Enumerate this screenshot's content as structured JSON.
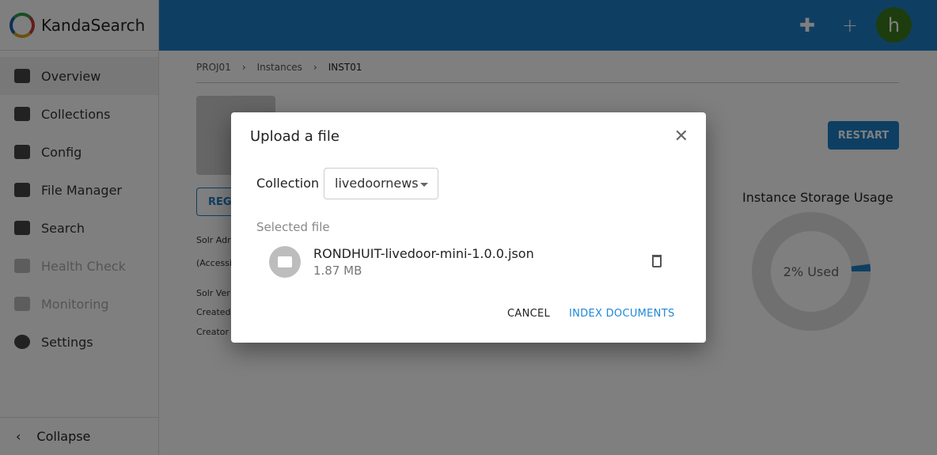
{
  "app": {
    "name": "KandaSearch"
  },
  "sidebar": {
    "items": [
      {
        "label": "Overview",
        "icon": "book-open-icon",
        "active": true
      },
      {
        "label": "Collections",
        "icon": "server-icon"
      },
      {
        "label": "Config",
        "icon": "cloud-config-icon"
      },
      {
        "label": "File Manager",
        "icon": "folder-icon"
      },
      {
        "label": "Search",
        "icon": "file-search-icon"
      },
      {
        "label": "Health Check",
        "icon": "plus-box-icon",
        "disabled": true
      },
      {
        "label": "Monitoring",
        "icon": "chart-box-icon",
        "disabled": true
      },
      {
        "label": "Settings",
        "icon": "gear-icon"
      }
    ],
    "collapse": "Collapse"
  },
  "topbar": {
    "avatar": "h"
  },
  "breadcrumb": [
    "PROJ01",
    "Instances",
    "INST01"
  ],
  "page": {
    "register_label": "REG",
    "restart": "RESTART",
    "info": [
      "Solr Adr",
      "(Accessi",
      "Solr Ver",
      "Created",
      "Creator"
    ]
  },
  "storage": {
    "title": "Instance Storage Usage",
    "label": "2% Used",
    "used_percent": 2,
    "color": "#1d7ec6"
  },
  "dialog": {
    "title": "Upload a file",
    "collection_label": "Collection",
    "collection_value": "livedoornews",
    "selected_file_label": "Selected file",
    "file_name": "RONDHUIT-livedoor-mini-1.0.0.json",
    "file_size": "1.87 MB",
    "cancel": "CANCEL",
    "index": "INDEX DOCUMENTS"
  }
}
